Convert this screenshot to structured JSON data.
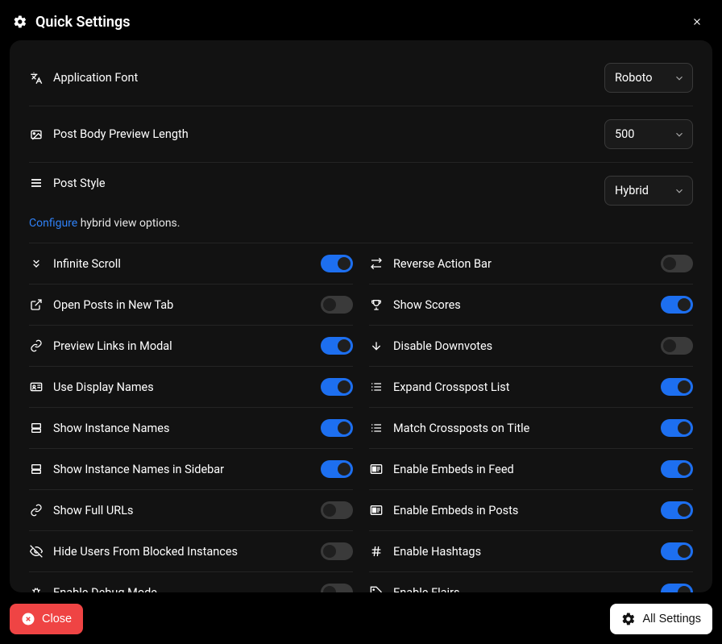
{
  "title": "Quick Settings",
  "rows": [
    {
      "icon": "translate",
      "label": "Application Font",
      "select": "Roboto"
    },
    {
      "icon": "image",
      "label": "Post Body Preview Length",
      "select": "500"
    },
    {
      "icon": "lines",
      "label": "Post Style",
      "select": "Hybrid",
      "sub_link": "Configure",
      "sub_text": " hybrid view options."
    }
  ],
  "toggles_left": [
    {
      "icon": "chevrons-down",
      "label": "Infinite Scroll",
      "on": true
    },
    {
      "icon": "external",
      "label": "Open Posts in New Tab",
      "on": false
    },
    {
      "icon": "link",
      "label": "Preview Links in Modal",
      "on": true
    },
    {
      "icon": "id",
      "label": "Use Display Names",
      "on": true
    },
    {
      "icon": "server",
      "label": "Show Instance Names",
      "on": true
    },
    {
      "icon": "server",
      "label": "Show Instance Names in Sidebar",
      "on": true
    },
    {
      "icon": "link",
      "label": "Show Full URLs",
      "on": false
    },
    {
      "icon": "eye-off",
      "label": "Hide Users From Blocked Instances",
      "on": false
    },
    {
      "icon": "bug",
      "label": "Enable Debug Mode",
      "on": false
    }
  ],
  "toggles_right": [
    {
      "icon": "swap",
      "label": "Reverse Action Bar",
      "on": false
    },
    {
      "icon": "trophy",
      "label": "Show Scores",
      "on": true
    },
    {
      "icon": "arrow-down",
      "label": "Disable Downvotes",
      "on": false
    },
    {
      "icon": "list",
      "label": "Expand Crosspost List",
      "on": true
    },
    {
      "icon": "list",
      "label": "Match Crossposts on Title",
      "on": true
    },
    {
      "icon": "embed",
      "label": "Enable Embeds in Feed",
      "on": true
    },
    {
      "icon": "embed",
      "label": "Enable Embeds in Posts",
      "on": true
    },
    {
      "icon": "hash",
      "label": "Enable Hashtags",
      "on": true
    },
    {
      "icon": "tag",
      "label": "Enable Flairs",
      "on": true
    }
  ],
  "footer": {
    "close": "Close",
    "all_settings": "All Settings"
  }
}
